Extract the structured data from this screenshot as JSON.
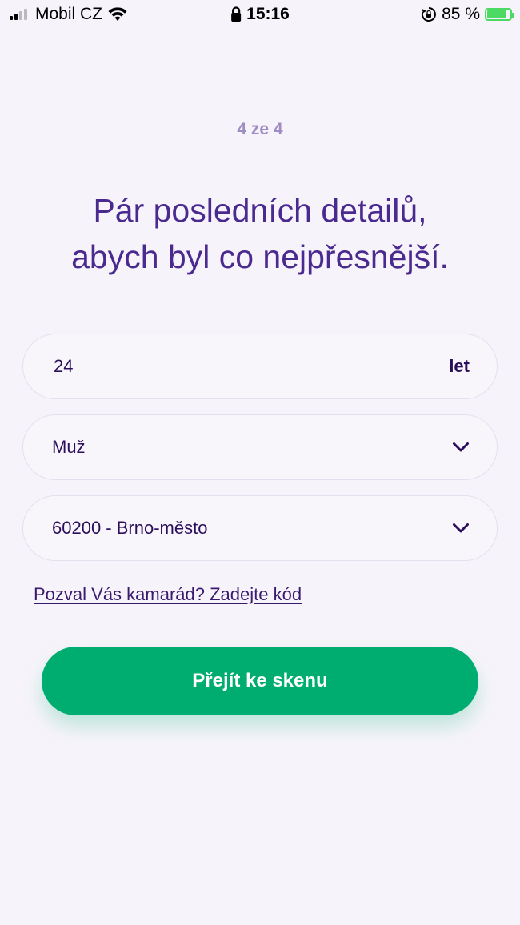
{
  "status_bar": {
    "carrier": "Mobil CZ",
    "time": "15:16",
    "battery_text": "85 %",
    "battery_level": 0.85,
    "signal_icon": "signal-bars-icon",
    "wifi_icon": "wifi-icon",
    "lock_icon": "lock-icon",
    "rotation_icon": "rotation-lock-icon",
    "battery_icon": "battery-charging-icon"
  },
  "step_label": "4 ze 4",
  "headline": {
    "line1": "Pár posledních detailů,",
    "line2": "abych byl co nejpřesnější."
  },
  "form": {
    "age": {
      "value": "24",
      "unit": "let"
    },
    "gender": {
      "value": "Muž",
      "icon": "chevron-down-icon"
    },
    "region": {
      "value": "60200 - Brno-město",
      "icon": "chevron-down-icon"
    }
  },
  "invite_link": "Pozval Vás kamarád? Zadejte kód",
  "cta_label": "Přejít ke skenu",
  "colors": {
    "primary_purple": "#4b2a8f",
    "step_purple": "#a08cc4",
    "cta_green": "#00ad70",
    "background": "#f6f4fa"
  }
}
